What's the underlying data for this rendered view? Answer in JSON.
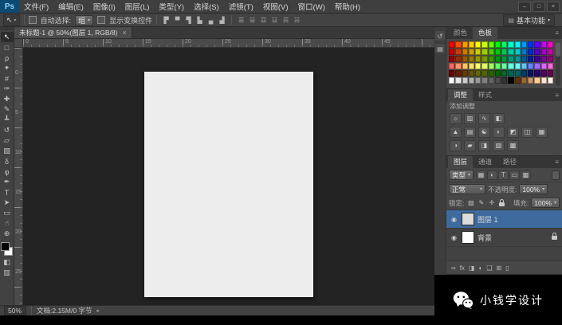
{
  "window": {
    "controls": [
      "–",
      "□",
      "×"
    ]
  },
  "ui": {
    "dd_glyph": "▾",
    "menu_glyph": "≡",
    "eye_glyph": "◉"
  },
  "colors": {
    "selected_layer": "#3E6A9D",
    "panel_bg": "#474747",
    "canvas_bg": "#232323",
    "document_bg": "#EDEDED",
    "logo_bg": "#0D4A73"
  },
  "menubar": {
    "logo": "Ps",
    "items": [
      "文件(F)",
      "编辑(E)",
      "图像(I)",
      "图层(L)",
      "类型(Y)",
      "选择(S)",
      "滤镜(T)",
      "视图(V)",
      "窗口(W)",
      "帮助(H)"
    ]
  },
  "optionsbar": {
    "tool_glyph": "↖",
    "auto_select_label": "自动选择:",
    "auto_select_value": "组",
    "show_transform_label": "显示变换控件",
    "align_icons": [
      {
        "name": "align-left-edges-icon",
        "glyph": "▛"
      },
      {
        "name": "align-horizontal-centers-icon",
        "glyph": "▀"
      },
      {
        "name": "align-right-edges-icon",
        "glyph": "▜"
      },
      {
        "name": "align-top-edges-icon",
        "glyph": "▙"
      },
      {
        "name": "align-vertical-centers-icon",
        "glyph": "▄"
      },
      {
        "name": "align-bottom-edges-icon",
        "glyph": "▟"
      }
    ],
    "distribute_icons": [
      {
        "name": "distribute-top-icon",
        "glyph": "☰"
      },
      {
        "name": "distribute-vertical-centers-icon",
        "glyph": "☱"
      },
      {
        "name": "distribute-bottom-icon",
        "glyph": "☲"
      },
      {
        "name": "distribute-left-icon",
        "glyph": "☳"
      },
      {
        "name": "distribute-horizontal-centers-icon",
        "glyph": "☴"
      },
      {
        "name": "distribute-right-icon",
        "glyph": "☵"
      }
    ],
    "workspace_icon": "▤",
    "workspace": "基本功能"
  },
  "tabbar": {
    "title": "未标题-1 @ 50%(图层 1, RGB/8)",
    "close_glyph": "×"
  },
  "rulers": {
    "h": [
      "0",
      "5",
      "10",
      "15",
      "20",
      "25",
      "30",
      "35",
      "40",
      "45"
    ],
    "v": [
      "0",
      "5",
      "10",
      "15",
      "20",
      "25"
    ]
  },
  "toolbar": {
    "foreground": "#000000",
    "background": "#ffffff",
    "tools": [
      {
        "name": "move-tool",
        "glyph": "↖",
        "active": true
      },
      {
        "name": "rectangular-marquee-tool",
        "glyph": "□"
      },
      {
        "name": "lasso-tool",
        "glyph": "ρ"
      },
      {
        "name": "quick-selection-tool",
        "glyph": "✦"
      },
      {
        "name": "crop-tool",
        "glyph": "#"
      },
      {
        "name": "eyedropper-tool",
        "glyph": "✑"
      },
      {
        "name": "spot-healing-brush-tool",
        "glyph": "✚"
      },
      {
        "name": "brush-tool",
        "glyph": "✎"
      },
      {
        "name": "clone-stamp-tool",
        "glyph": "┻"
      },
      {
        "name": "history-brush-tool",
        "glyph": "↺"
      },
      {
        "name": "eraser-tool",
        "glyph": "▱"
      },
      {
        "name": "gradient-tool",
        "glyph": "▧"
      },
      {
        "name": "blur-tool",
        "glyph": "δ"
      },
      {
        "name": "dodge-tool",
        "glyph": "φ"
      },
      {
        "name": "pen-tool",
        "glyph": "✒"
      },
      {
        "name": "type-tool",
        "glyph": "T"
      },
      {
        "name": "path-selection-tool",
        "glyph": "➤"
      },
      {
        "name": "shape-tool",
        "glyph": "▭"
      },
      {
        "name": "hand-tool",
        "glyph": "☝"
      },
      {
        "name": "zoom-tool",
        "glyph": "⊕"
      }
    ],
    "extras": [
      {
        "name": "quick-mask-mode-button",
        "glyph": "◧"
      },
      {
        "name": "screen-mode-button",
        "glyph": "▥"
      }
    ]
  },
  "statusbar": {
    "zoom": "50%",
    "doc_info": "文档:2.15M/0 字节",
    "arrow": "▸"
  },
  "panels": {
    "collapsed": [
      {
        "name": "history-panel-icon",
        "glyph": "↺"
      },
      {
        "name": "properties-panel-icon",
        "glyph": "▤"
      }
    ],
    "color_group": {
      "tabs": [
        {
          "name": "tab-color",
          "label": "颜色",
          "active": false
        },
        {
          "name": "tab-swatches",
          "label": "色板",
          "active": true
        }
      ],
      "swatches": [
        "#FF0000",
        "#FF4D00",
        "#FF9900",
        "#FFCC00",
        "#FFFF00",
        "#CCFF00",
        "#66FF00",
        "#00FF00",
        "#00FF66",
        "#00FFCC",
        "#00FFFF",
        "#0099FF",
        "#0033FF",
        "#6600FF",
        "#CC00FF",
        "#FF00CC",
        "#CC0000",
        "#CC3E00",
        "#CC7A00",
        "#CCA300",
        "#CCCC00",
        "#A3CC00",
        "#52CC00",
        "#00CC00",
        "#00CC52",
        "#00CCA3",
        "#00CCCC",
        "#007ACC",
        "#0029CC",
        "#5200CC",
        "#A300CC",
        "#CC00A3",
        "#990000",
        "#992E00",
        "#995C00",
        "#997A00",
        "#999900",
        "#7A9900",
        "#3D9900",
        "#009900",
        "#00993D",
        "#00997A",
        "#009999",
        "#005C99",
        "#001F99",
        "#3D0099",
        "#7A0099",
        "#99007A",
        "#FF6666",
        "#FF9466",
        "#FFC266",
        "#FFE066",
        "#FFFF66",
        "#E0FF66",
        "#A3FF66",
        "#66FF66",
        "#66FFA3",
        "#66FFE0",
        "#66FFFF",
        "#66C2FF",
        "#6685FF",
        "#A366FF",
        "#E066FF",
        "#FF66E0",
        "#660000",
        "#661F00",
        "#663D00",
        "#665200",
        "#666600",
        "#526600",
        "#296600",
        "#006600",
        "#006629",
        "#006652",
        "#006666",
        "#003D66",
        "#001466",
        "#290066",
        "#520066",
        "#660052",
        "#FFFFFF",
        "#E6E6E6",
        "#CCCCCC",
        "#B3B3B3",
        "#999999",
        "#808080",
        "#666666",
        "#4D4D4D",
        "#333333",
        "#000000",
        "#663300",
        "#996633",
        "#CC9966",
        "#FFCC99",
        "#FFE6CC",
        "#FFF2E6"
      ]
    },
    "adjust_group": {
      "tabs": [
        {
          "name": "tab-adjustments",
          "label": "调整",
          "active": true
        },
        {
          "name": "tab-styles",
          "label": "样式",
          "active": false
        }
      ],
      "label": "添加调整",
      "row1": [
        {
          "name": "adj-brightness-contrast-icon",
          "glyph": "☼"
        },
        {
          "name": "adj-levels-icon",
          "glyph": "▥"
        },
        {
          "name": "adj-curves-icon",
          "glyph": "∿"
        },
        {
          "name": "adj-exposure-icon",
          "glyph": "◧"
        }
      ],
      "row2": [
        {
          "name": "adj-vibrance-icon",
          "glyph": "▲"
        },
        {
          "name": "adj-hue-saturation-icon",
          "glyph": "▤"
        },
        {
          "name": "adj-color-balance-icon",
          "glyph": "☯"
        },
        {
          "name": "adj-black-white-icon",
          "glyph": "◐"
        },
        {
          "name": "adj-photo-filter-icon",
          "glyph": "◩"
        },
        {
          "name": "adj-channel-mixer-icon",
          "glyph": "◫"
        },
        {
          "name": "adj-color-lookup-icon",
          "glyph": "▦"
        }
      ],
      "row3": [
        {
          "name": "adj-invert-icon",
          "glyph": "◑"
        },
        {
          "name": "adj-posterize-icon",
          "glyph": "▰"
        },
        {
          "name": "adj-threshold-icon",
          "glyph": "◨"
        },
        {
          "name": "adj-gradient-map-icon",
          "glyph": "▧"
        },
        {
          "name": "adj-selective-color-icon",
          "glyph": "▩"
        }
      ]
    },
    "layers_group": {
      "tabs": [
        {
          "name": "tab-layers",
          "label": "图层",
          "active": true
        },
        {
          "name": "tab-channels",
          "label": "通道",
          "active": false
        },
        {
          "name": "tab-paths",
          "label": "路径",
          "active": false
        }
      ],
      "filter_label": "类型",
      "filter_icons": [
        {
          "name": "filter-pixel-layers-icon",
          "glyph": "▦"
        },
        {
          "name": "filter-adjustment-layers-icon",
          "glyph": "◐"
        },
        {
          "name": "filter-type-layers-icon",
          "glyph": "T"
        },
        {
          "name": "filter-shape-layers-icon",
          "glyph": "▭"
        },
        {
          "name": "filter-smart-objects-icon",
          "glyph": "▩"
        }
      ],
      "blend_mode": "正常",
      "opacity_label": "不透明度:",
      "opacity": "100%",
      "lock_label": "锁定:",
      "lock_icons": [
        {
          "name": "lock-transparent-pixels-icon",
          "glyph": "▨"
        },
        {
          "name": "lock-image-pixels-icon",
          "glyph": "✎"
        },
        {
          "name": "lock-position-icon",
          "glyph": "✛"
        },
        {
          "name": "lock-all-icon",
          "glyph": "",
          "lock": true
        }
      ],
      "fill_label": "填充:",
      "fill": "100%",
      "layers": [
        {
          "name": "图层 1",
          "selected": true,
          "thumb": "#dcdcdc",
          "locked": false
        },
        {
          "name": "背景",
          "selected": false,
          "thumb": "#ffffff",
          "locked": true
        }
      ],
      "bottom_icons": [
        {
          "name": "link-layers-icon",
          "glyph": "∞"
        },
        {
          "name": "layer-style-icon",
          "glyph": "fx"
        },
        {
          "name": "add-layer-mask-icon",
          "glyph": "◨"
        },
        {
          "name": "new-adjustment-layer-icon",
          "glyph": "◐"
        },
        {
          "name": "new-group-icon",
          "glyph": "❑"
        },
        {
          "name": "new-layer-icon",
          "glyph": "⊞"
        },
        {
          "name": "delete-layer-icon",
          "glyph": "▯"
        }
      ]
    }
  },
  "watermark": {
    "text": "小钱学设计"
  }
}
